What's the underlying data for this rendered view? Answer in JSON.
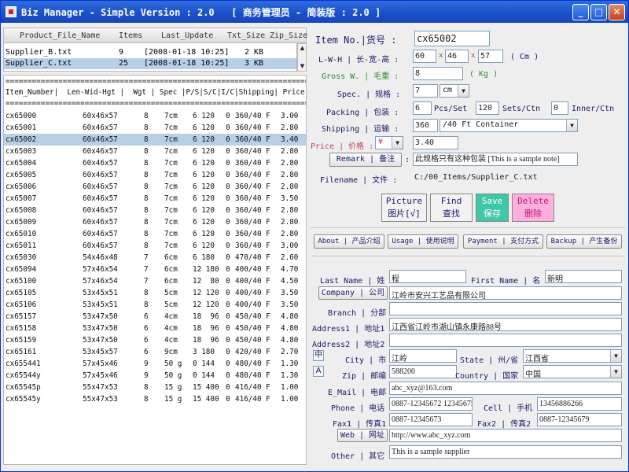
{
  "window": {
    "title": "Biz Manager - Simple Version : 2.0   [ 商务管理员 - 简装版 : 2.0 ]",
    "controls": {
      "minimize": "_",
      "maximize": "□",
      "close": "✕"
    }
  },
  "file_table": {
    "headers": [
      "Product_File_Name",
      "Items",
      "Last_Update",
      "Txt_Size",
      "Zip_Size"
    ],
    "rows": [
      {
        "name": "Supplier_B.txt",
        "items": "9",
        "updated": "[2008-01-18 10:25]",
        "txt": "2 KB",
        "zip": ""
      },
      {
        "name": "Supplier_C.txt",
        "items": "25",
        "updated": "[2008-01-18 10:25]",
        "txt": "3 KB",
        "zip": ""
      }
    ],
    "selected_index": 1
  },
  "item_list": {
    "divider": "========================================================================",
    "header": "Item_Number|  Len-Wid-Hgt |  Wgt | Spec |P/S|S/C|I/C|Shipping| Price",
    "rows": [
      [
        "cx65000",
        "60x46x57",
        "8",
        "7cm",
        "6 120",
        "0",
        "360/40 F",
        "3.00"
      ],
      [
        "cx65001",
        "60x46x57",
        "8",
        "7cm",
        "6 120",
        "0",
        "360/40 F",
        "2.80"
      ],
      [
        "cx65002",
        "60x46x57",
        "8",
        "7cm",
        "6 120",
        "0",
        "360/40 F",
        "3.40"
      ],
      [
        "cx65003",
        "60x46x57",
        "8",
        "7cm",
        "6 120",
        "0",
        "360/40 F",
        "2.80"
      ],
      [
        "cx65004",
        "60x46x57",
        "8",
        "7cm",
        "6 120",
        "0",
        "360/40 F",
        "2.80"
      ],
      [
        "cx65005",
        "60x46x57",
        "8",
        "7cm",
        "6 120",
        "0",
        "360/40 F",
        "2.80"
      ],
      [
        "cx65006",
        "60x46x57",
        "8",
        "7cm",
        "6 120",
        "0",
        "360/40 F",
        "2.80"
      ],
      [
        "cx65007",
        "60x46x57",
        "8",
        "7cm",
        "6 120",
        "0",
        "360/40 F",
        "3.50"
      ],
      [
        "cx65008",
        "60x46x57",
        "8",
        "7cm",
        "6 120",
        "0",
        "360/40 F",
        "2.80"
      ],
      [
        "cx65009",
        "60x46x57",
        "8",
        "7cm",
        "6 120",
        "0",
        "360/40 F",
        "2.80"
      ],
      [
        "cx65010",
        "60x46x57",
        "8",
        "7cm",
        "6 120",
        "0",
        "360/40 F",
        "2.80"
      ],
      [
        "cx65011",
        "60x46x57",
        "8",
        "7cm",
        "6 120",
        "0",
        "360/40 F",
        "3.00"
      ],
      [
        "cx65030",
        "54x46x48",
        "7",
        "6cm",
        "6 180",
        "0",
        "470/40 F",
        "2.60"
      ],
      [
        "cx65094",
        "57x46x54",
        "7",
        "6cm",
        "12 180",
        "0",
        "400/40 F",
        "4.70"
      ],
      [
        "cx65100",
        "57x46x54",
        "7",
        "6cm",
        "12  80",
        "0",
        "400/40 F",
        "4.50"
      ],
      [
        "cx65105",
        "53x45x51",
        "8",
        "5cm",
        "12 120",
        "0",
        "400/40 F",
        "3.50"
      ],
      [
        "cx65106",
        "53x45x51",
        "8",
        "5cm",
        "12 120",
        "0",
        "400/40 F",
        "3.50"
      ],
      [
        "cx65157",
        "53x47x50",
        "6",
        "4cm",
        "18  96",
        "0",
        "450/40 F",
        "4.80"
      ],
      [
        "cx65158",
        "53x47x50",
        "6",
        "4cm",
        "18  96",
        "0",
        "450/40 F",
        "4.80"
      ],
      [
        "cx65159",
        "53x47x50",
        "6",
        "4cm",
        "18  96",
        "0",
        "450/40 F",
        "4.80"
      ],
      [
        "cx65161",
        "53x45x57",
        "6",
        "9cm",
        "3 180",
        "0",
        "420/40 F",
        "2.70"
      ],
      [
        "cx655441",
        "57x45x46",
        "9",
        "50 g",
        "0 144",
        "0",
        "480/40 F",
        "1.30"
      ],
      [
        "cx65544y",
        "57x45x46",
        "9",
        "50 g",
        "0 144",
        "0",
        "480/40 F",
        "1.30"
      ],
      [
        "cx65545p",
        "55x47x53",
        "8",
        "15 g",
        "15 400",
        "0",
        "416/40 F",
        "1.00"
      ],
      [
        "cx65545y",
        "55x47x53",
        "8",
        "15 g",
        "15 400",
        "0",
        "416/40 F",
        "1.00"
      ]
    ],
    "selected_index": 2
  },
  "detail": {
    "item_no_label": "Item No.|货号 :",
    "item_no": "cx65002",
    "lwh_label": "L-W-H | 长-宽-高 :",
    "len": "60",
    "wid": "46",
    "hgt": "57",
    "lwh_times": "x",
    "lwh_unit": "( Cm )",
    "gross_label": "Gross W. | 毛重 :",
    "gross": "8",
    "gross_unit": "( Kg )",
    "spec_label": "Spec. | 规格 :",
    "spec": "7",
    "spec_unit": "cm",
    "packing_label": "Packing | 包装 :",
    "pcs_set": "6",
    "pcs_set_label": "Pcs/Set",
    "sets_ctn": "120",
    "sets_ctn_label": "Sets/Ctn",
    "inner_ctn": "0",
    "inner_ctn_label": "Inner/Ctn",
    "shipping_label": "Shipping | 运输 :",
    "shipping_qty": "360",
    "shipping_container": "/40 Ft Container",
    "price_label": "Price | 价格 :",
    "currency": "¥",
    "price": "3.40",
    "remark_button": "Remark | 备注",
    "remark_colon": ":",
    "remark": "此规格只有这种包装 [This is a sample note]",
    "filename_label": "Filename | 文件 :",
    "filename": "C:/00_Items/Supplier_C.txt"
  },
  "actions": {
    "picture": {
      "line1": "Picture",
      "line2": "图片[√]"
    },
    "find": {
      "line1": "Find",
      "line2": "查找"
    },
    "save": {
      "line1": "Save",
      "line2": "保存"
    },
    "delete": {
      "line1": "Delete",
      "line2": "删除"
    }
  },
  "nav_buttons": [
    "About | 产品介绍",
    "Usage | 使用说明",
    "Payment | 支付方式",
    "Backup | 产生备份"
  ],
  "contact": {
    "last_name_label": "Last Name | 姓",
    "last_name": "程",
    "first_name_label": "First Name | 名",
    "first_name": "新明",
    "company_button": "Company | 公司",
    "company": "江岭市安兴工艺品有限公司",
    "branch_label": "Branch | 分部",
    "branch": "",
    "address1_label": "Address1 | 地址1",
    "address1": "江西省江岭市湖山镇永康路88号",
    "address2_label": "Address2 | 地址2",
    "address2": "",
    "zh_toggle": "中",
    "en_toggle": "A",
    "city_label": "City | 市",
    "city": "江岭",
    "state_label": "State | 州/省",
    "state": "江西省",
    "zip_label": "Zip | 邮编",
    "zip": "588200",
    "country_label": "Country | 国家",
    "country": "中国",
    "email_label": "E_Mail | 电邮",
    "email": "abc_xyz@163.com",
    "phone_label": "Phone | 电话",
    "phone": "0887-12345672 12345675",
    "cell_label": "Cell | 手机",
    "cell": "13456886266",
    "fax1_label": "Fax1 | 传真1",
    "fax1": "0887-12345673",
    "fax2_label": "Fax2 | 传真2",
    "fax2": "0887-12345679",
    "web_button": "Web | 网址",
    "web": "http://www.abc_xyz.com",
    "other_label": "Other | 其它",
    "other": "This is a sample supplier"
  },
  "icons": {
    "dropdown": "▼",
    "scroll_up": "▲",
    "scroll_down": "▼"
  },
  "colors": {
    "title_bar": "#1a4fc8",
    "label_blue": "#1a1a6a",
    "gross_green": "#2e8b2e",
    "price_red": "#c04060",
    "selection": "#b8cfe5",
    "picture_btn": "#f2f2f2",
    "find_btn": "#f2f2f2",
    "save_btn": "#3ec8a8",
    "delete_btn": "#ffaee0"
  }
}
